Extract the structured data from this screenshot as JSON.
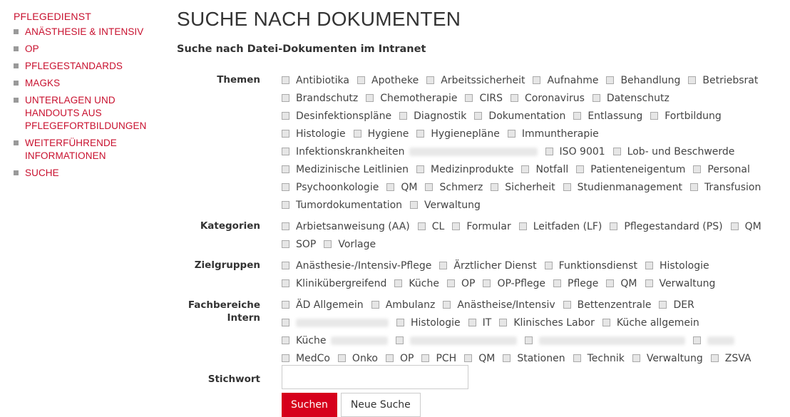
{
  "sidebar": {
    "heading": "PFLEGEDIENST",
    "items": [
      {
        "label": "ANÄSTHESIE & INTENSIV"
      },
      {
        "label": "OP"
      },
      {
        "label": "PFLEGESTANDARDS"
      },
      {
        "label": "MAGKS"
      },
      {
        "label": "UNTERLAGEN UND HANDOUTS AUS PFLEGEFORTBILDUNGEN"
      },
      {
        "label": "WEITERFÜHRENDE INFORMATIONEN"
      },
      {
        "label": "SUCHE"
      }
    ]
  },
  "main": {
    "title": "SUCHE NACH DOKUMENTEN",
    "subtitle": "Suche nach Datei-Dokumenten im Intranet"
  },
  "form": {
    "themen_label": "Themen",
    "themen": [
      "Antibiotika",
      "Apotheke",
      "Arbeitssicherheit",
      "Aufnahme",
      "Behandlung",
      "Betriebsrat",
      "Brandschutz",
      "Chemotherapie",
      "CIRS",
      "Coronavirus",
      "Datenschutz",
      "Desinfektionspläne",
      "Diagnostik",
      "Dokumentation",
      "Entlassung",
      "Fortbildung",
      "Histologie",
      "Hygiene",
      "Hygienepläne",
      "Immuntherapie",
      "Infektionskrankheiten",
      "ISO 9001",
      "Lob- und Beschwerde",
      "Medizinische Leitlinien",
      "Medizinprodukte",
      "Notfall",
      "Patienteneigentum",
      "Personal",
      "Psychoonkologie",
      "QM",
      "Schmerz",
      "Sicherheit",
      "Studienmanagement",
      "Transfusion",
      "Tumordokumentation",
      "Verwaltung"
    ],
    "kategorien_label": "Kategorien",
    "kategorien": [
      "Arbietsanweisung (AA)",
      "CL",
      "Formular",
      "Leitfaden (LF)",
      "Pflegestandard (PS)",
      "QM",
      "SOP",
      "Vorlage"
    ],
    "zielgruppen_label": "Zielgruppen",
    "zielgruppen": [
      "Anästhesie-/Intensiv-Pflege",
      "Ärztlicher Dienst",
      "Funktionsdienst",
      "Histologie",
      "Klinikübergreifend",
      "Küche",
      "OP",
      "OP-Pflege",
      "Pflege",
      "QM",
      "Verwaltung"
    ],
    "fachbereiche_label": "Fachbereiche Intern",
    "fachbereiche_row1": [
      "ÄD Allgemein",
      "Ambulanz",
      "Anästheise/Intensiv",
      "Bettenzentrale",
      "DER"
    ],
    "fachbereiche_row2": [
      "Histologie",
      "IT",
      "Klinisches Labor",
      "Küche allgemein"
    ],
    "fachbereiche_row3": [
      "Küche"
    ],
    "fachbereiche_row4": [
      "MedCo",
      "Onko",
      "OP",
      "PCH",
      "QM",
      "Stationen",
      "Technik",
      "Verwaltung",
      "ZSVA"
    ],
    "stichwort_label": "Stichwort",
    "stichwort_value": "",
    "search_button": "Suchen",
    "reset_button": "Neue Suche"
  }
}
